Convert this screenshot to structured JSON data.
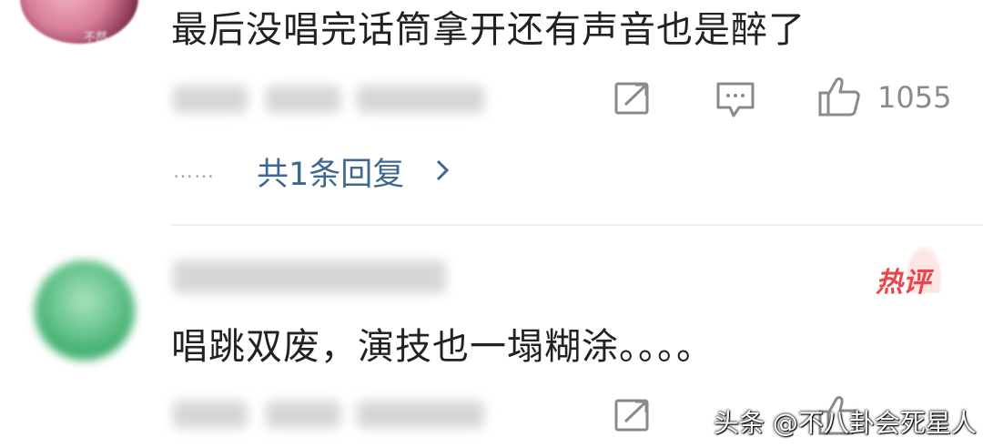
{
  "comments": [
    {
      "text": "最后没唱完话筒拿开还有声音也是醉了",
      "avatar_watermark": "不然",
      "like_count": "1055",
      "reply_link": "共1条回复",
      "reply_prefix": "……"
    },
    {
      "text": "唱跳双废，演技也一塌糊涂。。。。",
      "badge": "热评",
      "like_count": ""
    }
  ],
  "source_watermark": "头条 @不八卦会死星人",
  "icons": {
    "share": "share-icon",
    "comment": "comment-icon",
    "like": "thumbs-up-icon",
    "chevron": "chevron-right-icon"
  },
  "colors": {
    "text": "#222222",
    "meta": "#8a8a8a",
    "link": "#3f6890",
    "hot": "#e8474d"
  }
}
